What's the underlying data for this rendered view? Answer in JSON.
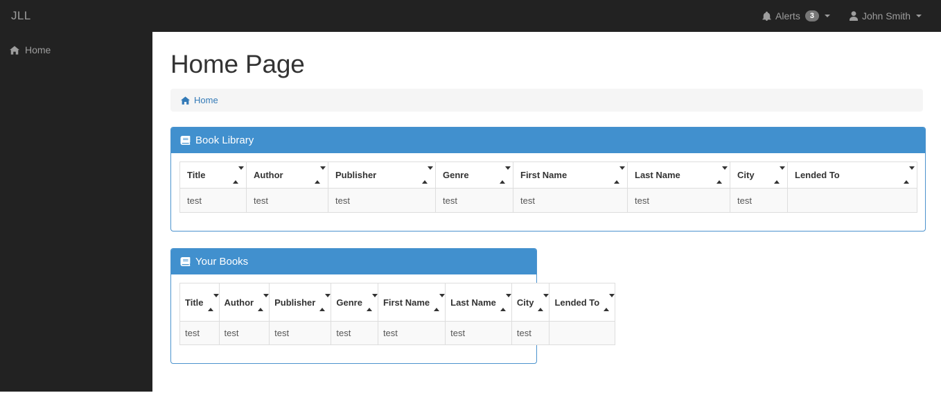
{
  "navbar": {
    "brand": "JLL",
    "alerts": {
      "label": "Alerts",
      "icon": "bell-icon",
      "badge": "3"
    },
    "user": {
      "label": "John Smith",
      "icon": "user-icon"
    }
  },
  "sidebar": {
    "items": [
      {
        "label": "Home",
        "icon": "home-icon"
      }
    ]
  },
  "page": {
    "title": "Home Page",
    "breadcrumb": [
      {
        "label": "Home",
        "icon": "home-icon"
      }
    ]
  },
  "panels": [
    {
      "title": "Book Library",
      "icon": "book-icon",
      "columns": [
        "Title",
        "Author",
        "Publisher",
        "Genre",
        "First Name",
        "Last Name",
        "City",
        "Lended To"
      ],
      "rows": [
        [
          "test",
          "test",
          "test",
          "test",
          "test",
          "test",
          "test",
          ""
        ]
      ]
    },
    {
      "title": "Your Books",
      "icon": "book-icon",
      "columns": [
        "Title",
        "Author",
        "Publisher",
        "Genre",
        "First Name",
        "Last Name",
        "City",
        "Lended To"
      ],
      "rows": [
        [
          "test",
          "test",
          "test",
          "test",
          "test",
          "test",
          "test",
          ""
        ]
      ]
    }
  ],
  "colors": {
    "navbar_bg": "#222222",
    "sidebar_bg": "#222222",
    "panel_header": "#4190ce",
    "panel_border": "#4a92cd",
    "link": "#337ab7",
    "badge_bg": "#777777",
    "row_bg": "#f9f9f9"
  }
}
